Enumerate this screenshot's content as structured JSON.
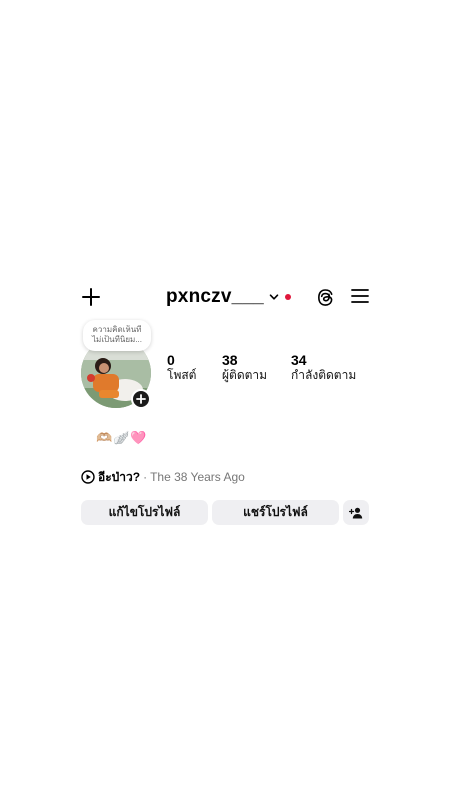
{
  "header": {
    "username": "pxnczv___",
    "notification_dot_color": "#e0173b",
    "icons": [
      "plus-icon",
      "chevron-down-icon",
      "threads-icon",
      "hamburger-menu-icon"
    ]
  },
  "profile": {
    "note_line1": "ความคิดเห็นที่",
    "note_line2": "ไม่เป็นที่นิยม..."
  },
  "stats": {
    "posts": {
      "value": "0",
      "label": "โพสต์"
    },
    "followers": {
      "value": "38",
      "label": "ผู้ติดตาม"
    },
    "following": {
      "value": "34",
      "label": "กำลังติดตาม"
    }
  },
  "bio": {
    "emoji": "🫶🏼🪽🩷"
  },
  "music": {
    "title": "อีะป่าว?",
    "separator": "·",
    "artist": "The 38 Years Ago"
  },
  "actions": {
    "edit_label": "แก้ไขโปรไฟล์",
    "share_label": "แชร์โปรไฟล์"
  }
}
